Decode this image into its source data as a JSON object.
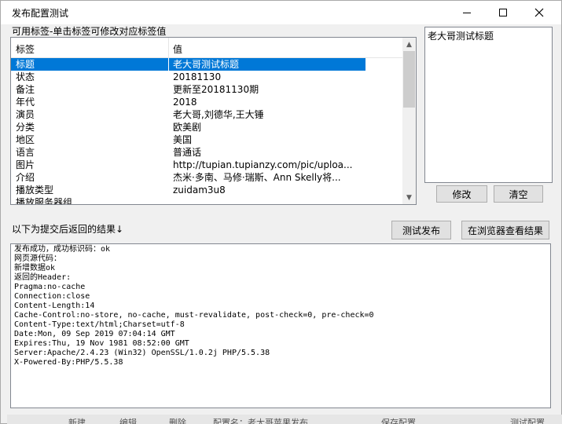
{
  "window": {
    "title": "发布配置测试"
  },
  "labels_section": {
    "caption": "可用标签-单击标签可修改对应标签值",
    "columns": [
      "标签",
      "值"
    ],
    "rows": [
      {
        "label": "标题",
        "value": "老大哥测试标题",
        "selected": true
      },
      {
        "label": "状态",
        "value": "20181130"
      },
      {
        "label": "备注",
        "value": "更新至20181130期"
      },
      {
        "label": "年代",
        "value": "2018"
      },
      {
        "label": "演员",
        "value": "老大哥,刘德华,王大锤"
      },
      {
        "label": "分类",
        "value": "欧美剧"
      },
      {
        "label": "地区",
        "value": "美国"
      },
      {
        "label": "语言",
        "value": "普通话"
      },
      {
        "label": "图片",
        "value": "http://tupian.tupianzy.com/pic/uploa..."
      },
      {
        "label": "介绍",
        "value": "杰米·多南、马修·瑞斯、Ann Skelly将..."
      },
      {
        "label": "播放类型",
        "value": "zuidam3u8"
      },
      {
        "label": "播放服务器组",
        "value": ""
      }
    ]
  },
  "preview": {
    "value": "老大哥测试标题"
  },
  "buttons": {
    "modify": "修改",
    "clear": "清空",
    "test_publish": "测试发布",
    "view_in_browser": "在浏览器查看结果"
  },
  "result_section": {
    "caption": "以下为提交后返回的结果↓",
    "text": "发布成功，成功标识码：ok\n网页源代码：\n新增数据ok\n返回的Header:\nPragma:no-cache\nConnection:close\nContent-Length:14\nCache-Control:no-store, no-cache, must-revalidate, post-check=0, pre-check=0\nContent-Type:text/html;Charset=utf-8\nDate:Mon, 09 Sep 2019 07:04:14 GMT\nExpires:Thu, 19 Nov 1981 08:52:00 GMT\nServer:Apache/2.4.23 (Win32) OpenSSL/1.0.2j PHP/5.5.38\nX-Powered-By:PHP/5.5.38"
  },
  "background_strip": {
    "items": [
      "新建",
      "编辑",
      "删除",
      "配置名：老大哥苹果发布",
      "保存配置",
      "测试配置"
    ]
  },
  "colors": {
    "selection": "#0078d7",
    "window_bg": "#f0f0f0"
  }
}
